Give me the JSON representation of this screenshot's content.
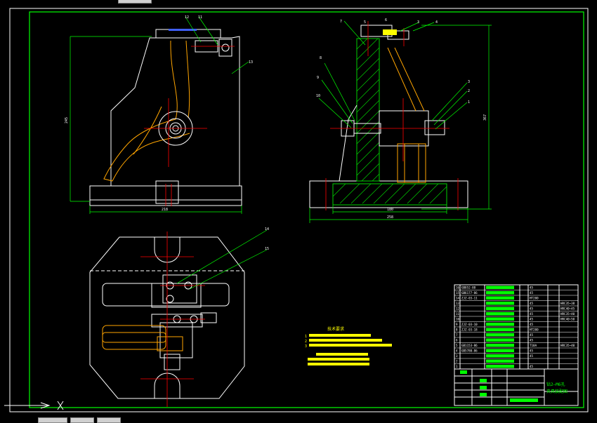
{
  "drawing": {
    "balloons": {
      "front": [
        "12",
        "11",
        "13"
      ],
      "side": [
        "7",
        "5",
        "6",
        "3",
        "4",
        "8",
        "9",
        "10",
        "3",
        "2",
        "1"
      ],
      "top": [
        "14",
        "15"
      ]
    },
    "dimensions": {
      "front_height": "245",
      "front_width": "218",
      "side_height": "367",
      "side_inner_width": "180",
      "side_width": "258"
    },
    "tech_req": {
      "title": "技术要求",
      "items": [
        "1",
        "2",
        "3"
      ]
    },
    "title_block": {
      "code": "钻2—M6孔",
      "name": "夹具装配图"
    },
    "bom": [
      {
        "no": "16",
        "spec": "GB852-88",
        "mat": "45"
      },
      {
        "no": "15",
        "spec": "GB6177-86",
        "mat": "45"
      },
      {
        "no": "14",
        "spec": "ZJZ-03-11",
        "mat": "HT200"
      },
      {
        "no": "13",
        "spec": "",
        "mat": "45",
        "std": "HRC35~38"
      },
      {
        "no": "12",
        "spec": "",
        "mat": "45",
        "std": "HRC40~45"
      },
      {
        "no": "11",
        "spec": "",
        "mat": "45",
        "std": "HRC35~40"
      },
      {
        "no": "10",
        "spec": "",
        "mat": "45",
        "std": "HRC40~50"
      },
      {
        "no": "9",
        "spec": "ZJZ-03-10",
        "mat": "45"
      },
      {
        "no": "8",
        "spec": "ZJZ-03-18",
        "mat": "HT200"
      },
      {
        "no": "7",
        "spec": "",
        "mat": "45"
      },
      {
        "no": "6",
        "spec": "",
        "mat": "45"
      },
      {
        "no": "5",
        "spec": "GB1153-86",
        "mat": "T10A",
        "std": "HRC35~40"
      },
      {
        "no": "4",
        "spec": "GB5780-86",
        "mat": "45"
      },
      {
        "no": "3",
        "spec": "",
        "mat": "45"
      },
      {
        "no": "2",
        "spec": "",
        "mat": ""
      },
      {
        "no": "1",
        "spec": "",
        "mat": "45"
      }
    ]
  },
  "colors": {
    "background": "#000000",
    "outline": "#ffffff",
    "center": "#ff0000",
    "dim": "#00ff00",
    "hidden": "#ffa500",
    "hatch": "#00d000",
    "label": "#ffff00",
    "frame": "#00ff00"
  }
}
